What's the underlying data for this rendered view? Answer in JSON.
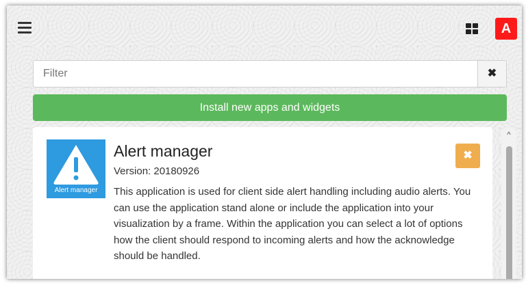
{
  "header": {
    "menu_icon": "hamburger-menu-icon",
    "grid_icon": "grid-view-icon",
    "user_badge": "A",
    "user_badge_color": "#ff1a1a"
  },
  "filter": {
    "placeholder": "Filter",
    "value": "",
    "clear_symbol": "✖"
  },
  "install_button": {
    "label": "Install new apps and widgets",
    "color": "#5cb85c"
  },
  "apps": [
    {
      "icon_label": "Alert manager",
      "icon_color": "#2e9ae0",
      "title": "Alert manager",
      "version": "Version: 20180926",
      "description": "This application is used for client side alert handling including audio alerts. You can use the application stand alone or include the application into your visualization by a frame. Within the application you can select a lot of options how the client should respond to incoming alerts and how the acknowledge should be handled.",
      "remove_symbol": "✖",
      "remove_color": "#f0ad4e"
    }
  ],
  "scrollbar": {
    "up_symbol": "^"
  }
}
